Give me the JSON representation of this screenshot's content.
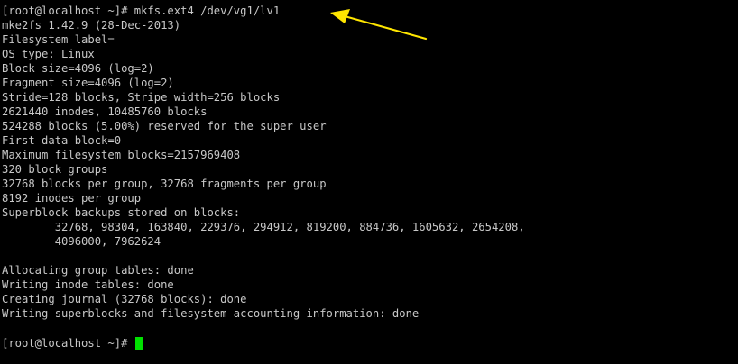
{
  "terminal": {
    "command_line": "[root@localhost ~]# mkfs.ext4 /dev/vg1/lv1",
    "output": [
      "mke2fs 1.42.9 (28-Dec-2013)",
      "Filesystem label=",
      "OS type: Linux",
      "Block size=4096 (log=2)",
      "Fragment size=4096 (log=2)",
      "Stride=128 blocks, Stripe width=256 blocks",
      "2621440 inodes, 10485760 blocks",
      "524288 blocks (5.00%) reserved for the super user",
      "First data block=0",
      "Maximum filesystem blocks=2157969408",
      "320 block groups",
      "32768 blocks per group, 32768 fragments per group",
      "8192 inodes per group",
      "Superblock backups stored on blocks:",
      "        32768, 98304, 163840, 229376, 294912, 819200, 884736, 1605632, 2654208,",
      "        4096000, 7962624"
    ],
    "output_after": [
      "Allocating group tables: done",
      "Writing inode tables: done",
      "Creating journal (32768 blocks): done",
      "Writing superblocks and filesystem accounting information: done"
    ],
    "prompt": "[root@localhost ~]# "
  },
  "colors": {
    "background": "#000000",
    "text": "#c8c8c8",
    "cursor": "#00e000",
    "arrow": "#ffe600"
  }
}
